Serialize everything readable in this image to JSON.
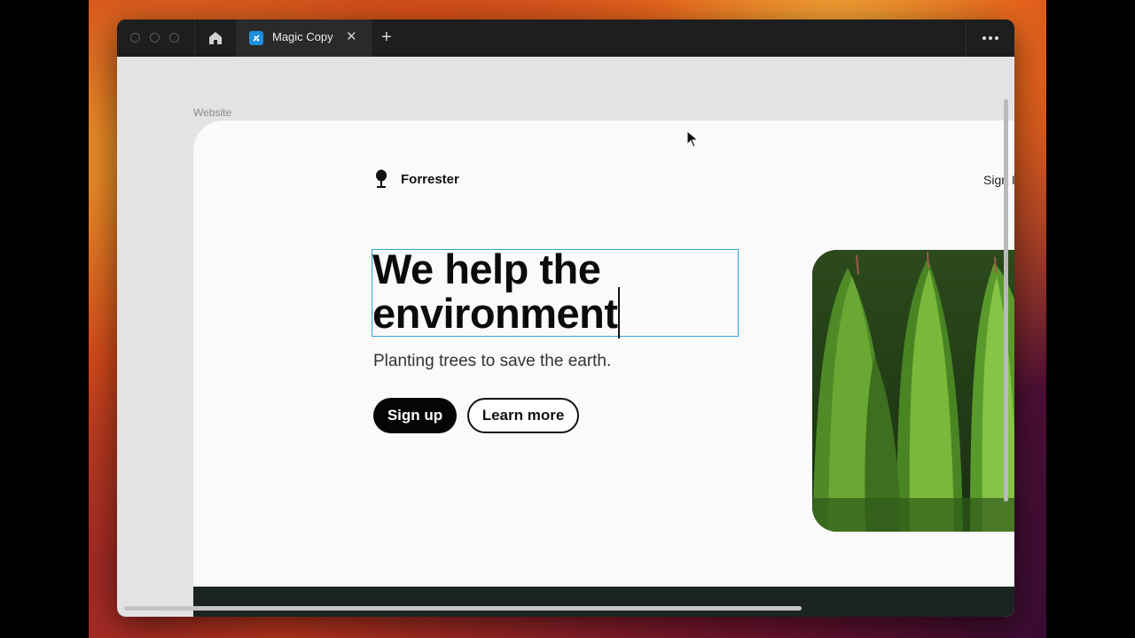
{
  "window": {
    "tab_title": "Magic Copy",
    "tab_icon": "magic-copy-app-icon",
    "new_tab_glyph": "+",
    "close_glyph": "✕"
  },
  "canvas": {
    "frame_label": "Website"
  },
  "site": {
    "brand": "Forrester",
    "logo_icon": "tree-icon",
    "nav_signin": "Sign I",
    "headline_line1": "We help the",
    "headline_line2": "environment",
    "subheadline": "Planting trees to save the earth.",
    "primary_button": "Sign up",
    "secondary_button": "Learn more",
    "hero_image": "evergreen-trees-photo"
  },
  "colors": {
    "selection": "#29a7e0",
    "tab_icon_bg": "#1d8fe0",
    "dark_band": "#1b2420"
  }
}
